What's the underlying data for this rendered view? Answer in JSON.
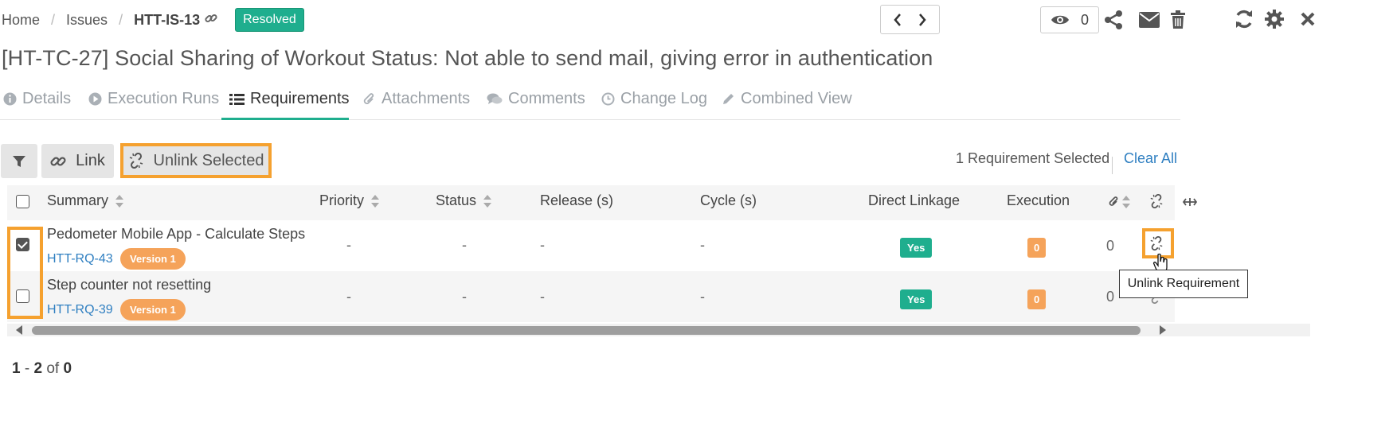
{
  "breadcrumb": {
    "home": "Home",
    "issues": "Issues",
    "sep": "/",
    "current": "HTT-IS-13",
    "status": "Resolved"
  },
  "toolbar": {
    "watch_count": "0"
  },
  "title": "[HT-TC-27] Social Sharing of Workout Status: Not able to send mail, giving error in authentication",
  "tabs": [
    {
      "label": "Details",
      "icon": "info-icon"
    },
    {
      "label": "Execution Runs",
      "icon": "play-icon"
    },
    {
      "label": "Requirements",
      "icon": "list-icon"
    },
    {
      "label": "Attachments",
      "icon": "paperclip-icon"
    },
    {
      "label": "Comments",
      "icon": "comments-icon"
    },
    {
      "label": "Change Log",
      "icon": "clock-icon"
    },
    {
      "label": "Combined View",
      "icon": "pencil-icon"
    }
  ],
  "actions": {
    "link_label": "Link",
    "unlink_label": "Unlink Selected",
    "selected_text": "1 Requirement Selected",
    "clear_all": "Clear All"
  },
  "table": {
    "headers": {
      "summary": "Summary",
      "priority": "Priority",
      "status": "Status",
      "release": "Release (s)",
      "cycle": "Cycle (s)",
      "direct": "Direct Linkage",
      "execution": "Execution"
    },
    "rows": [
      {
        "checked": true,
        "title": "Pedometer Mobile App - Calculate Steps",
        "id": "HTT-RQ-43",
        "version": "Version 1",
        "priority": "-",
        "status": "-",
        "release": "-",
        "cycle": "-",
        "direct": "Yes",
        "execution": "0",
        "attachments": "0"
      },
      {
        "checked": false,
        "title": "Step counter not resetting",
        "id": "HTT-RQ-39",
        "version": "Version 1",
        "priority": "-",
        "status": "-",
        "release": "-",
        "cycle": "-",
        "direct": "Yes",
        "execution": "0",
        "attachments": "0"
      }
    ]
  },
  "tooltip": "Unlink Requirement",
  "pager": {
    "from": "1",
    "dash": "-",
    "to": "2",
    "of": "of",
    "total": "0"
  },
  "colors": {
    "accent": "#1fae8e",
    "highlight": "#f5a12f",
    "link": "#2f7fc1",
    "badge_orange": "#f5a35a"
  }
}
